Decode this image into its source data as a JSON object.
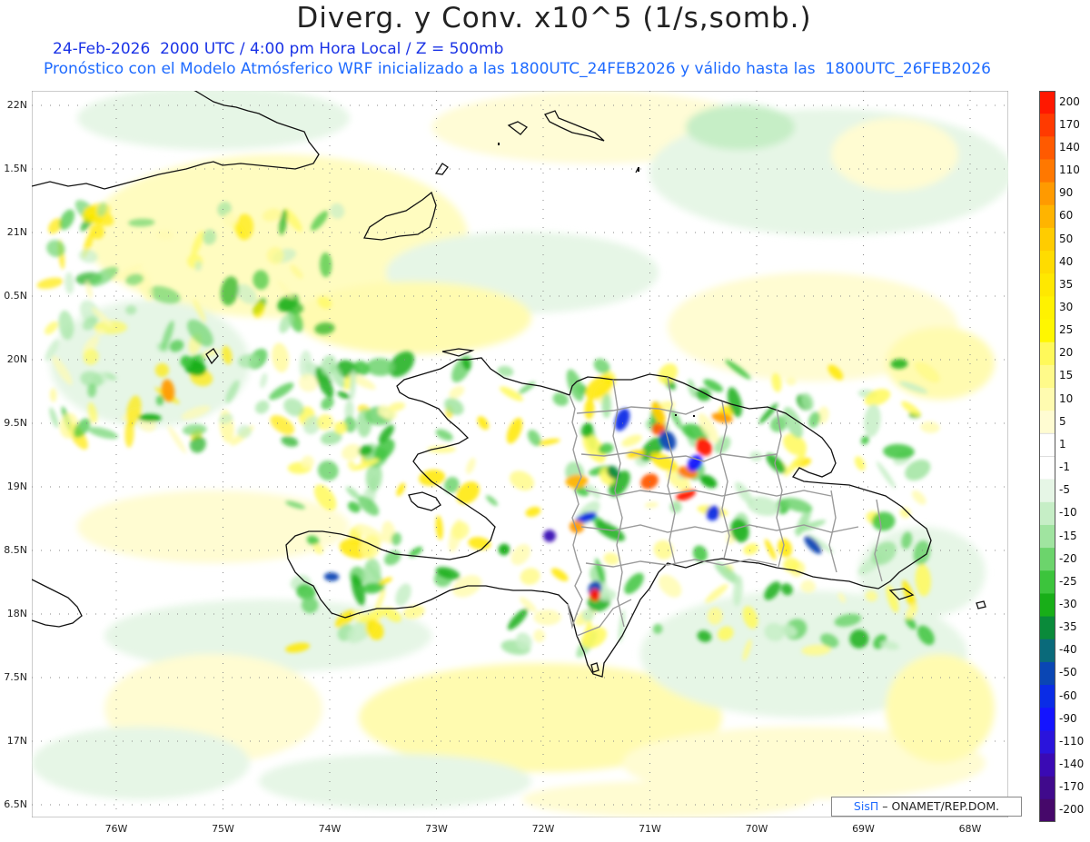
{
  "title": "Diverg. y Conv. x10^5 (1/s,somb.)",
  "subtitle_line1": "24-Feb-2026  2000 UTC / 4:00 pm Hora Local / Z = 500mb",
  "subtitle_line2": "Pronóstico con el Modelo Atmósferico WRF inicializado a las 1800UTC_24FEB2026 y válido hasta las  1800UTC_26FEB2026",
  "credit": {
    "brand": "SisΠ",
    "text": "– ONAMET/REP.DOM."
  },
  "map": {
    "lat_labels": [
      "22N",
      "1.5N",
      "21N",
      "0.5N",
      "20N",
      "9.5N",
      "19N",
      "8.5N",
      "18N",
      "7.5N",
      "17N",
      "6.5N"
    ],
    "lon_labels": [
      "76W",
      "75W",
      "74W",
      "73W",
      "72W",
      "71W",
      "70W",
      "69W",
      "68W"
    ],
    "lat_range": [
      16.5,
      22.0
    ],
    "lon_range": [
      -76.7,
      -67.4
    ]
  },
  "colorbar": {
    "labels": [
      "200",
      "170",
      "140",
      "110",
      "90",
      "60",
      "50",
      "40",
      "35",
      "30",
      "25",
      "20",
      "15",
      "10",
      "5",
      "1",
      "-1",
      "-5",
      "-10",
      "-15",
      "-20",
      "-25",
      "-30",
      "-35",
      "-40",
      "-50",
      "-60",
      "-90",
      "-110",
      "-140",
      "-170",
      "-200"
    ],
    "colors": [
      "#ff1800",
      "#ff3a00",
      "#ff5a00",
      "#ff7800",
      "#ff9a00",
      "#ffb400",
      "#ffcc00",
      "#ffdc00",
      "#ffe800",
      "#fff200",
      "#fff700",
      "#fff95a",
      "#fffa8a",
      "#fffbb0",
      "#fffcd2",
      "#ffffff",
      "#ffffff",
      "#e6f6e6",
      "#c6eec6",
      "#a0e4a0",
      "#6cd46c",
      "#3cc43c",
      "#18ae18",
      "#0a8a3a",
      "#0a6a7a",
      "#0a46b4",
      "#0a2ce6",
      "#1414ff",
      "#2a14dc",
      "#3a0ab4",
      "#400a8c",
      "#46086a"
    ]
  }
}
